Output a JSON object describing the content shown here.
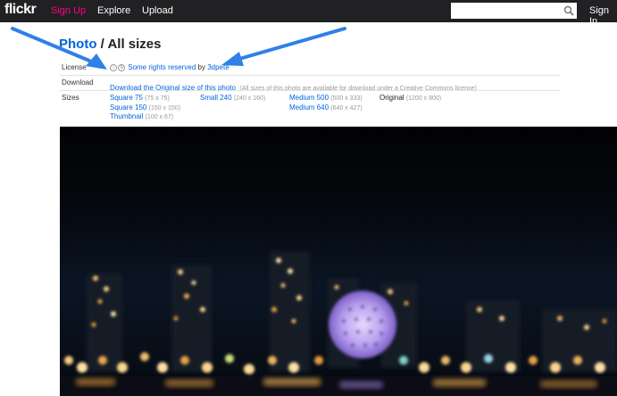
{
  "nav": {
    "logo": "flickr",
    "signup": "Sign Up",
    "explore": "Explore",
    "upload": "Upload",
    "search_value": "",
    "signin": "Sign In"
  },
  "title": {
    "prefix": "Photo",
    "rest": " / All sizes"
  },
  "license": {
    "label": "License",
    "link": "Some rights reserved",
    "by": "by",
    "author": "3dpete"
  },
  "download": {
    "label": "Download",
    "link": "Download the Original size of this photo",
    "note": "(All sizes of this photo are available for download under a Creative Commons license)"
  },
  "sizes": {
    "label": "Sizes",
    "items": [
      {
        "name": "Square 75",
        "dims": "(75 x 75)"
      },
      {
        "name": "Square 150",
        "dims": "(150 x 150)"
      },
      {
        "name": "Thumbnail",
        "dims": "(100 x 67)"
      },
      {
        "name": "Small 240",
        "dims": "(240 x 160)"
      },
      {
        "name": "Medium 500",
        "dims": "(500 x 333)"
      },
      {
        "name": "Medium 640",
        "dims": "(640 x 427)"
      },
      {
        "name": "Original",
        "dims": "(1200 x 800)"
      }
    ]
  },
  "colors": {
    "nav_bg": "#212124",
    "link": "#0063dc",
    "signup": "#ff0084",
    "annotation_arrow": "#2f80e8"
  }
}
